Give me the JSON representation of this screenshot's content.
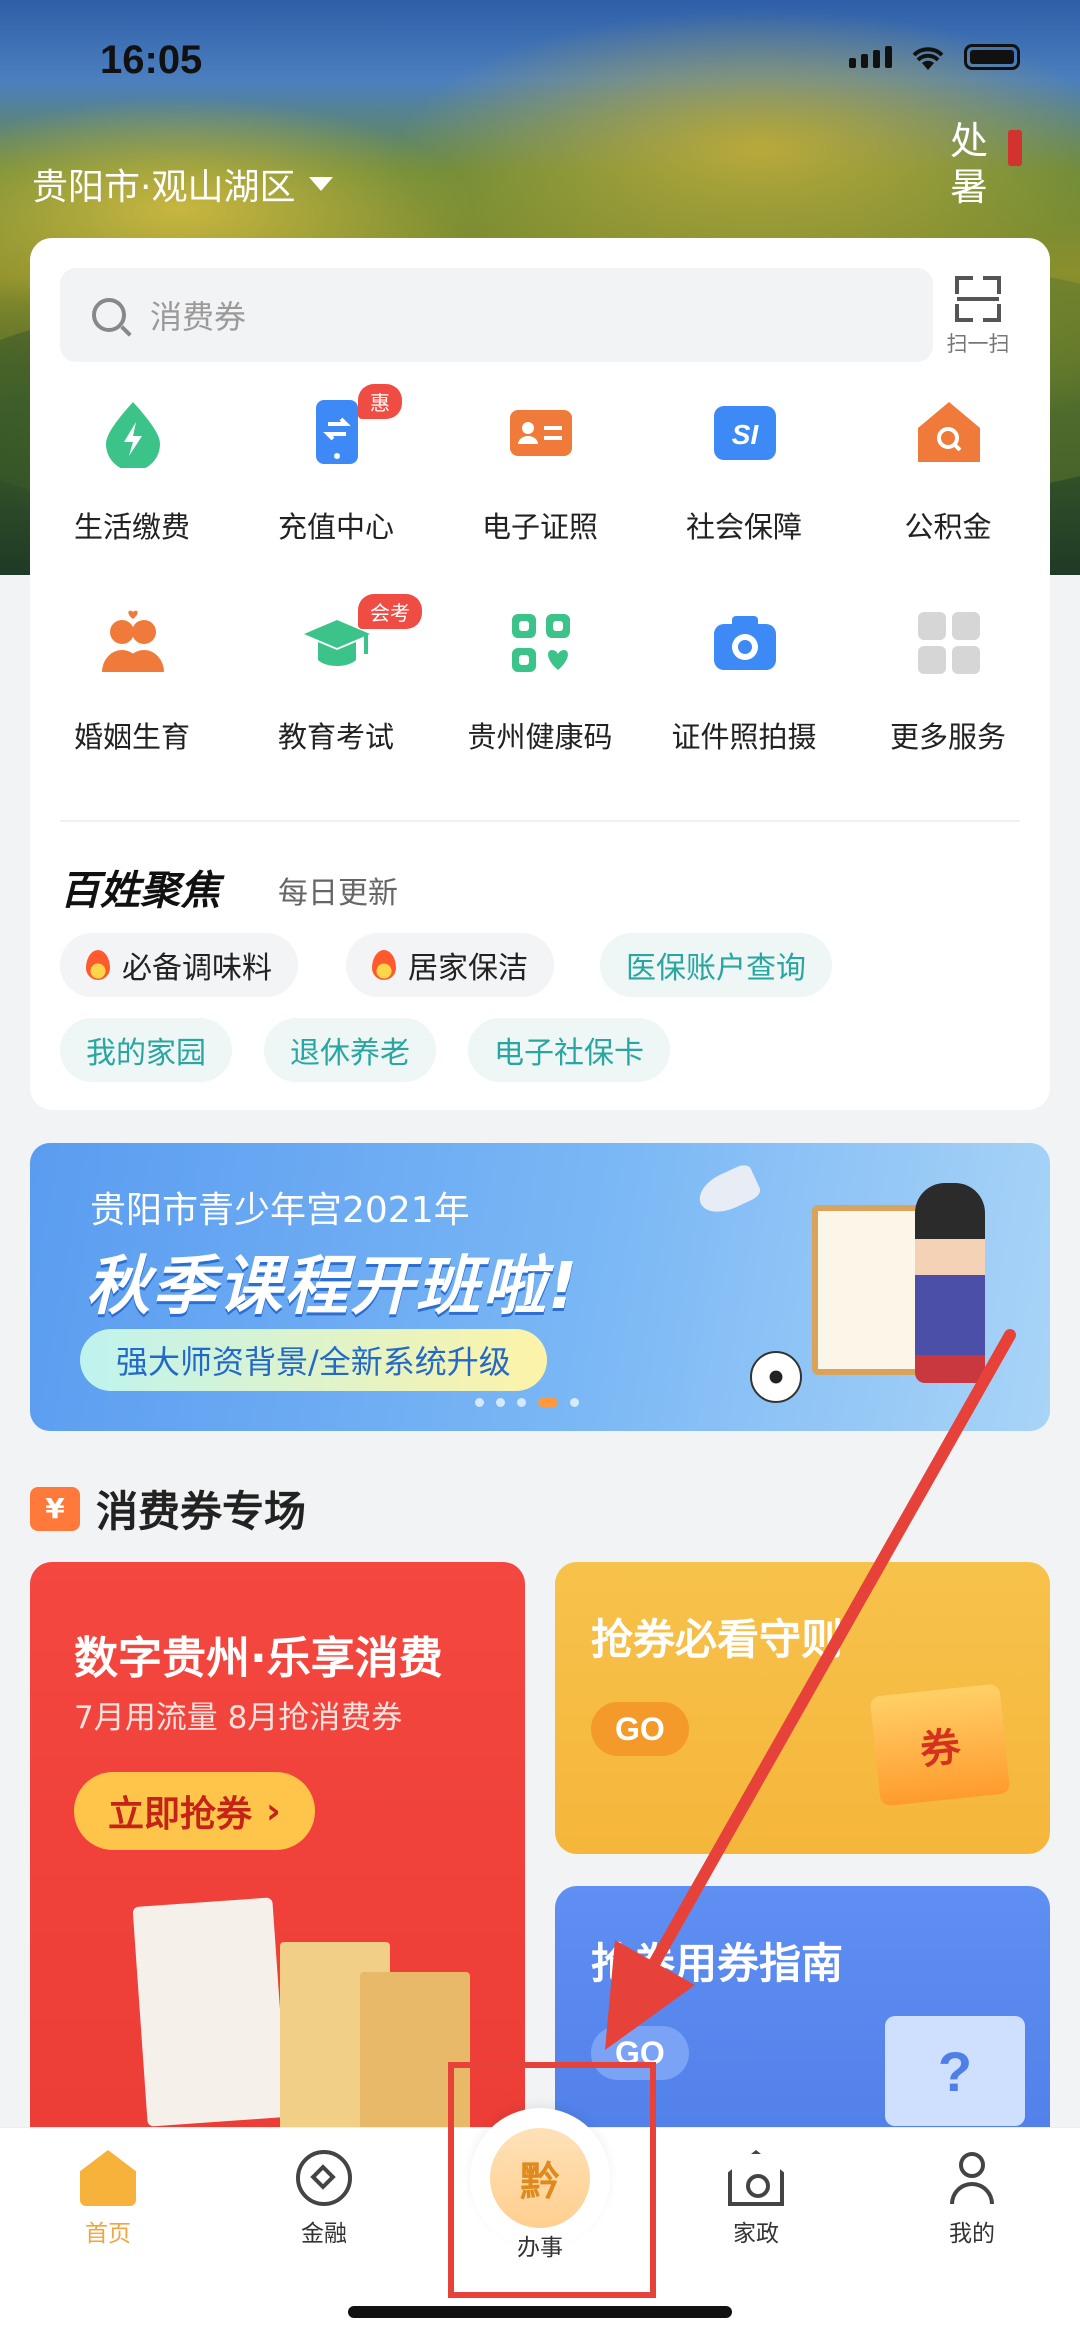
{
  "status_bar": {
    "time": "16:05"
  },
  "header": {
    "location": "贵阳市·观山湖区",
    "solar_term": "处暑"
  },
  "search": {
    "placeholder": "消费券",
    "scan_label": "扫一扫"
  },
  "services": [
    {
      "label": "生活缴费",
      "icon": "lightning-drop-icon",
      "color": "#3cc38a",
      "badge": ""
    },
    {
      "label": "充值中心",
      "icon": "phone-exchange-icon",
      "color": "#3d8af7",
      "badge": "惠"
    },
    {
      "label": "电子证照",
      "icon": "id-card-icon",
      "color": "#f07a3a",
      "badge": ""
    },
    {
      "label": "社会保障",
      "icon": "social-insurance-icon",
      "color": "#3d8af7",
      "badge": ""
    },
    {
      "label": "公积金",
      "icon": "house-search-icon",
      "color": "#f07a3a",
      "badge": ""
    },
    {
      "label": "婚姻生育",
      "icon": "couple-icon",
      "color": "#f07a3a",
      "badge": ""
    },
    {
      "label": "教育考试",
      "icon": "graduation-cap-icon",
      "color": "#3cc38a",
      "badge": "会考"
    },
    {
      "label": "贵州健康码",
      "icon": "health-code-icon",
      "color": "#3cc38a",
      "badge": ""
    },
    {
      "label": "证件照拍摄",
      "icon": "camera-icon",
      "color": "#3d8af7",
      "badge": ""
    },
    {
      "label": "更多服务",
      "icon": "more-grid-icon",
      "color": "#cfcfcf",
      "badge": ""
    }
  ],
  "focus": {
    "title": "百姓聚焦",
    "subtitle": "每日更新",
    "tags": [
      {
        "label": "必备调味料",
        "style": "hot"
      },
      {
        "label": "居家保洁",
        "style": "hot"
      },
      {
        "label": "医保账户查询",
        "style": "teal"
      },
      {
        "label": "我的家园",
        "style": "teal"
      },
      {
        "label": "退休养老",
        "style": "teal"
      },
      {
        "label": "电子社保卡",
        "style": "teal"
      }
    ]
  },
  "banner": {
    "line1": "贵阳市青少年宫2021年",
    "line2": "秋季课程开班啦!",
    "pill": "强大师资背景/全新系统升级",
    "active_slide": 4,
    "slide_count": 5
  },
  "coupon_section": {
    "icon_glyph": "¥",
    "title": "消费券专场",
    "main_card": {
      "title": "数字贵州·乐享消费",
      "subtitle": "7月用流量 8月抢消费券",
      "button": "立即抢券",
      "button_arrow": "›"
    },
    "card_guide": {
      "title": "抢券必看守则",
      "go": "GO",
      "coupon_glyph": "券"
    },
    "card_howto": {
      "title": "抢券用券指南",
      "go": "GO",
      "ticket_glyph": "?"
    }
  },
  "tabbar": {
    "tabs": [
      {
        "label": "首页",
        "icon": "home-icon",
        "active": true
      },
      {
        "label": "金融",
        "icon": "finance-icon",
        "active": false
      },
      {
        "label": "办事",
        "icon": "services-logo-icon",
        "active": false
      },
      {
        "label": "家政",
        "icon": "housekeeping-icon",
        "active": false
      },
      {
        "label": "我的",
        "icon": "profile-icon",
        "active": false
      }
    ]
  },
  "annotation": {
    "color": "#e6423a"
  }
}
